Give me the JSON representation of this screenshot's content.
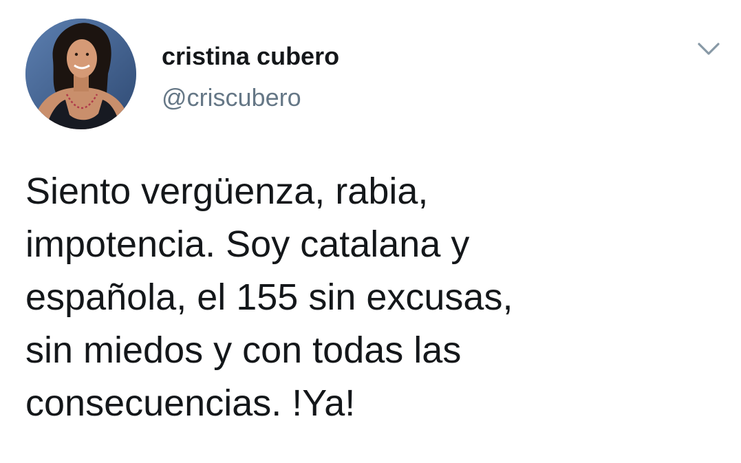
{
  "tweet": {
    "author": {
      "display_name": "cristina cubero",
      "handle": "@criscubero"
    },
    "menu_icon": "chevron-down-icon",
    "text": "Siento vergüenza, rabia,\nimpotencia. Soy catalana y\nespañola, el 155 sin excusas,\nsin miedos y con todas las\nconsecuencias. !Ya!"
  },
  "colors": {
    "text_primary": "#14171a",
    "text_secondary": "#657786",
    "caret": "#8899a6",
    "background": "#ffffff"
  }
}
